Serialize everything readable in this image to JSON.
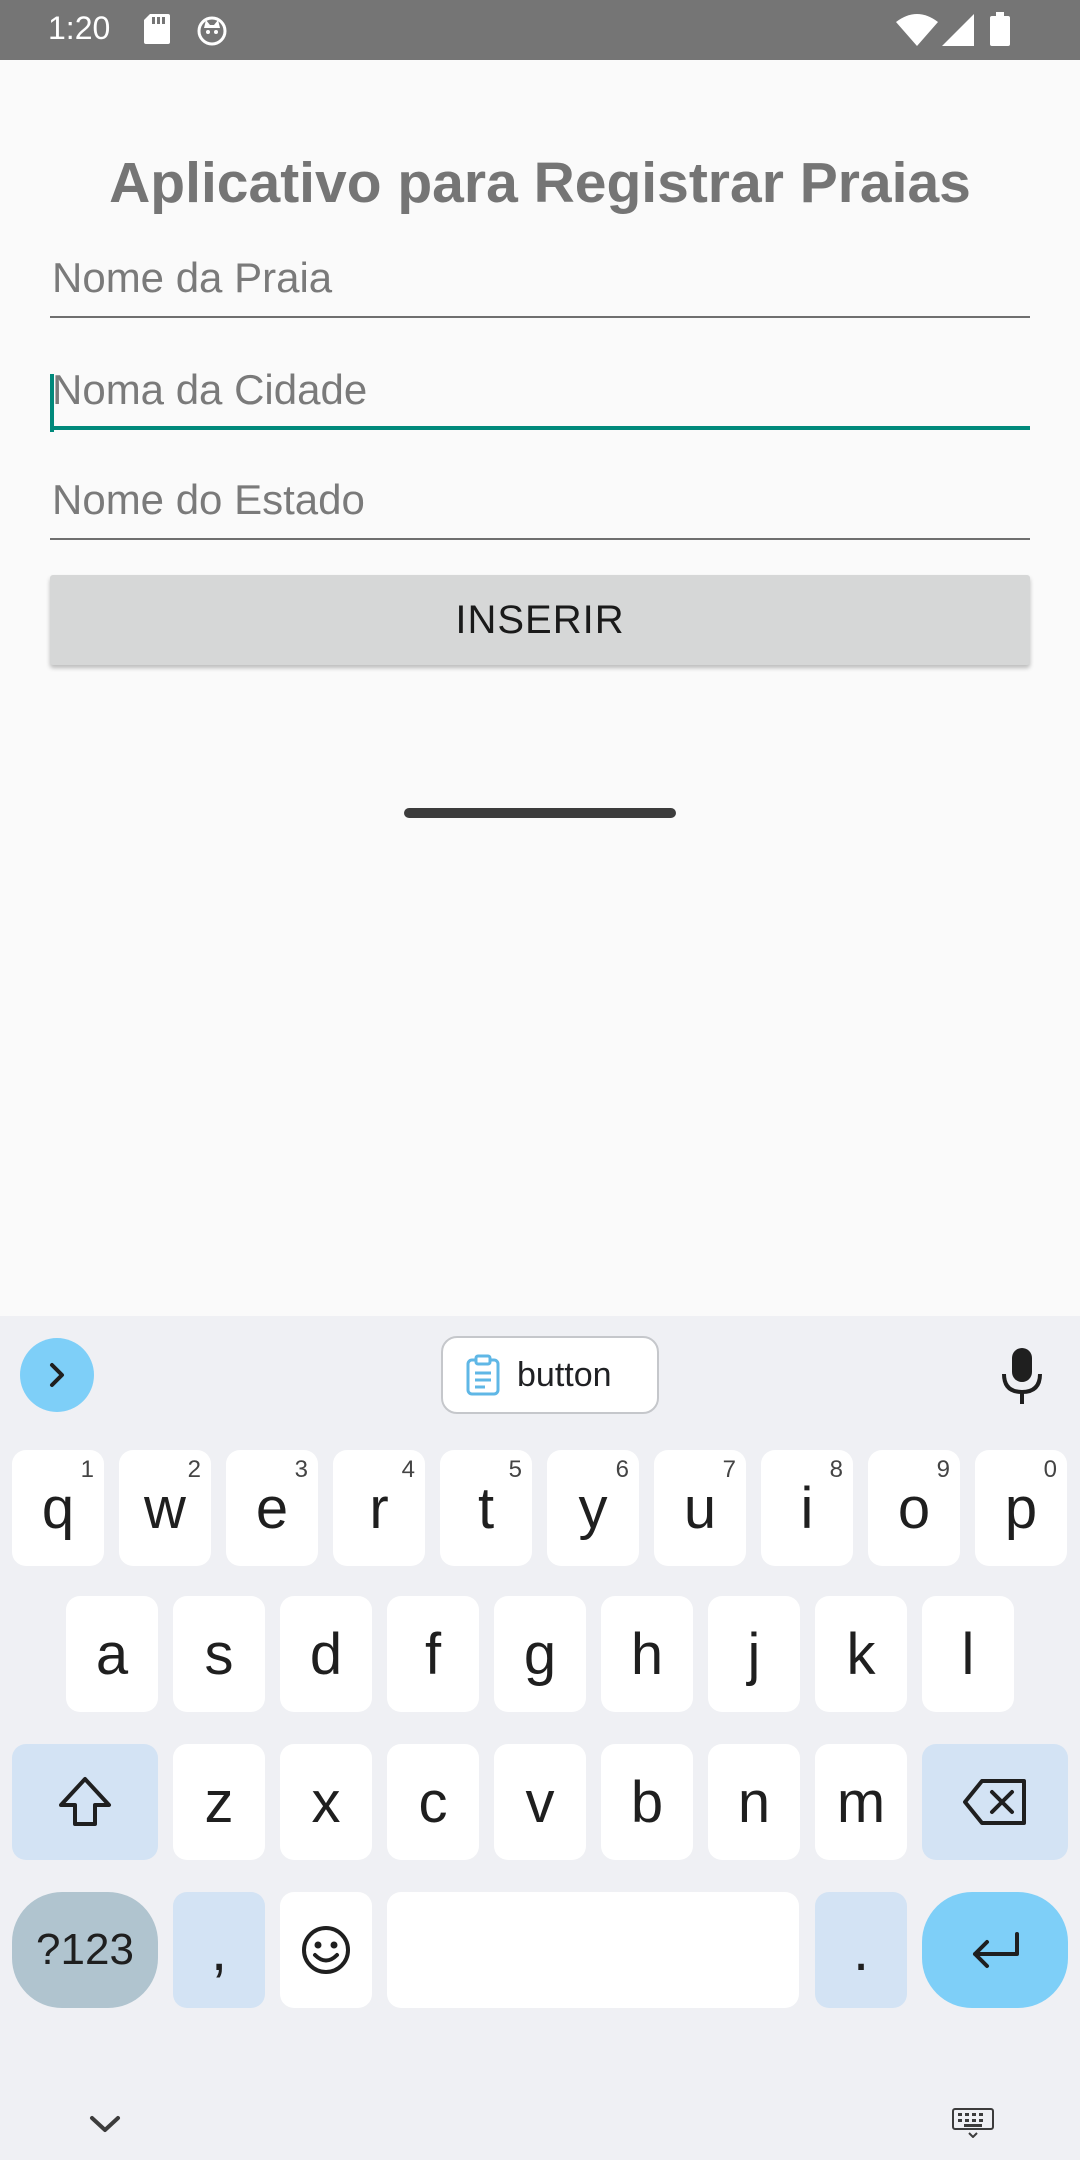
{
  "status_bar": {
    "time": "1:20"
  },
  "app": {
    "title": "Aplicativo para Registrar Praias",
    "fields": {
      "beach": {
        "placeholder": "Nome da Praia",
        "value": ""
      },
      "city": {
        "placeholder": "Noma da Cidade",
        "value": ""
      },
      "state": {
        "placeholder": "Nome do Estado",
        "value": ""
      }
    },
    "insert_button": "INSERIR",
    "accent_color": "#00897b"
  },
  "keyboard": {
    "clipboard_chip": "button",
    "row1": [
      {
        "key": "q",
        "hint": "1"
      },
      {
        "key": "w",
        "hint": "2"
      },
      {
        "key": "e",
        "hint": "3"
      },
      {
        "key": "r",
        "hint": "4"
      },
      {
        "key": "t",
        "hint": "5"
      },
      {
        "key": "y",
        "hint": "6"
      },
      {
        "key": "u",
        "hint": "7"
      },
      {
        "key": "i",
        "hint": "8"
      },
      {
        "key": "o",
        "hint": "9"
      },
      {
        "key": "p",
        "hint": "0"
      }
    ],
    "row2": [
      "a",
      "s",
      "d",
      "f",
      "g",
      "h",
      "j",
      "k",
      "l"
    ],
    "row3": [
      "z",
      "x",
      "c",
      "v",
      "b",
      "n",
      "m"
    ],
    "symbols_label": "?123",
    "comma": ",",
    "period": ".",
    "accent_color": "#7ecff8"
  }
}
